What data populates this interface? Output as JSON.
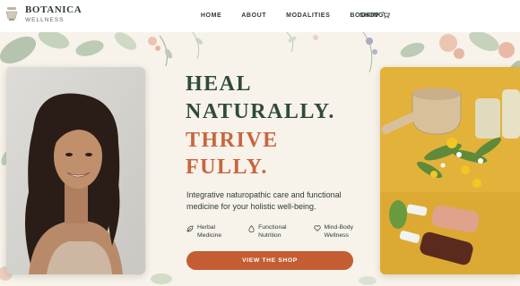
{
  "brand": {
    "name": "BOTANICA",
    "tagline": "WELLNESS"
  },
  "nav": {
    "items": [
      {
        "label": "HOME"
      },
      {
        "label": "ABOUT"
      },
      {
        "label": "MODALITIES"
      },
      {
        "label": "BOOKING"
      }
    ],
    "shop_label": "SHOP",
    "shop_icon": "cart-icon"
  },
  "hero": {
    "line1": "HEAL",
    "line2": "NATURALLY.",
    "line3": "THRIVE",
    "line4": "FULLY.",
    "description": "Integrative naturopathic care and functional medicine for your holistic well-being.",
    "features": [
      {
        "label1": "Herbal",
        "label2": "Medicine",
        "icon": "leaf-icon"
      },
      {
        "label1": "Functional",
        "label2": "Nutrition",
        "icon": "drop-icon"
      },
      {
        "label1": "Mind-Body",
        "label2": "Wellness",
        "icon": "heart-icon"
      }
    ],
    "cta_label": "VIEW THE SHOP"
  },
  "colors": {
    "heading_green": "#2f4a3b",
    "heading_orange": "#c9653f",
    "button": "#c45d33",
    "background": "#f7f3ea"
  }
}
